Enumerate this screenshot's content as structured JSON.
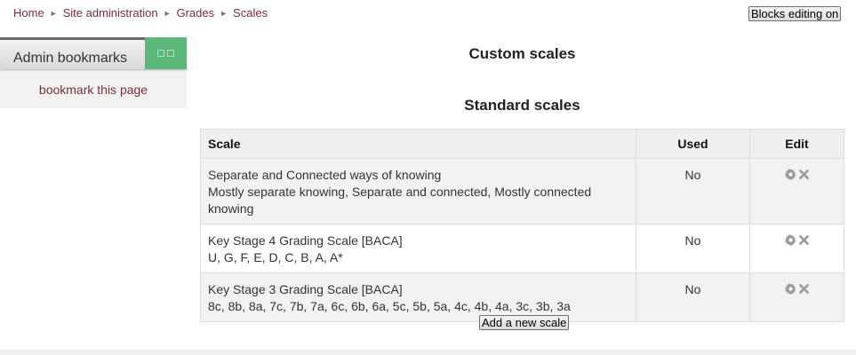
{
  "breadcrumb": [
    "Home",
    "Site administration",
    "Grades",
    "Scales"
  ],
  "header": {
    "blocks_editing_label": "Blocks editing on"
  },
  "block": {
    "title": "Admin bookmarks",
    "link": "bookmark this page",
    "controls": [
      "hide-block-icon",
      "move-block-icon"
    ]
  },
  "sections": {
    "custom_title": "Custom scales",
    "standard_title": "Standard scales"
  },
  "table": {
    "headers": {
      "scale": "Scale",
      "used": "Used",
      "edit": "Edit"
    },
    "rows": [
      {
        "name": "Separate and Connected ways of knowing",
        "items": "Mostly separate knowing, Separate and connected, Mostly connected knowing",
        "used": "No",
        "edit_icons": [
          "settings-icon",
          "delete-icon"
        ]
      },
      {
        "name": "Key Stage 4 Grading Scale [BACA]",
        "items": "U, G, F, E, D, C, B, A, A*",
        "used": "No",
        "edit_icons": [
          "settings-icon",
          "delete-icon"
        ]
      },
      {
        "name": "Key Stage 3 Grading Scale [BACA]",
        "items": "8c, 8b, 8a, 7c, 7b, 7a, 6c, 6b, 6a, 5c, 5b, 5a, 4c, 4b, 4a, 3c, 3b, 3a",
        "used": "No",
        "edit_icons": [
          "settings-icon",
          "delete-icon"
        ]
      }
    ]
  },
  "actions": {
    "add_scale_label": "Add a new scale"
  },
  "colors": {
    "link": "#7a2e3a",
    "block_controls": "#5cb87a",
    "row_alt": "#f2f2f2",
    "header_bg": "#efefef"
  }
}
